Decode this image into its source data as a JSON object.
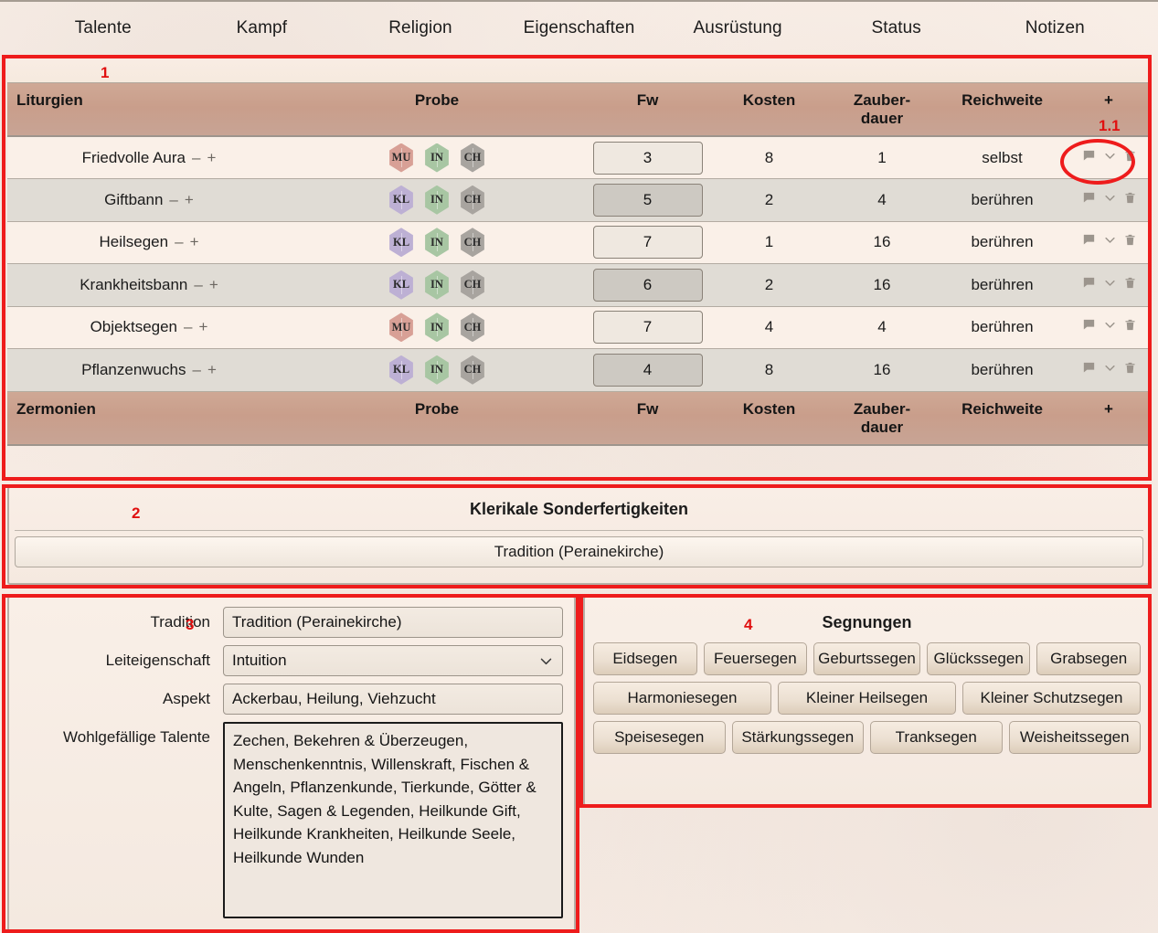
{
  "nav": {
    "items": [
      {
        "label": "Talente"
      },
      {
        "label": "Kampf"
      },
      {
        "label": "Religion"
      },
      {
        "label": "Eigenschaften"
      },
      {
        "label": "Ausrüstung"
      },
      {
        "label": "Status"
      },
      {
        "label": "Notizen"
      }
    ]
  },
  "annotations": {
    "n1": "1",
    "n1_1": "1.1",
    "n2": "2",
    "n3": "3",
    "n4": "4",
    "color": "#ee1c1c"
  },
  "liturgies": {
    "headers": {
      "name": "Liturgien",
      "probe": "Probe",
      "fw": "Fw",
      "kosten": "Kosten",
      "zauberdauer_1": "Zauber-",
      "zauberdauer_2": "dauer",
      "reichweite": "Reichweite",
      "add": "+"
    },
    "rows": [
      {
        "name": "Friedvolle Aura",
        "minus": "–",
        "plus": "+",
        "attrs": [
          "MU",
          "IN",
          "CH"
        ],
        "fw": "3",
        "kosten": "8",
        "zauberdauer": "1",
        "reichweite": "selbst"
      },
      {
        "name": "Giftbann",
        "minus": "–",
        "plus": "+",
        "attrs": [
          "KL",
          "IN",
          "CH"
        ],
        "fw": "5",
        "kosten": "2",
        "zauberdauer": "4",
        "reichweite": "berühren"
      },
      {
        "name": "Heilsegen",
        "minus": "–",
        "plus": "+",
        "attrs": [
          "KL",
          "IN",
          "CH"
        ],
        "fw": "7",
        "kosten": "1",
        "zauberdauer": "16",
        "reichweite": "berühren"
      },
      {
        "name": "Krankheitsbann",
        "minus": "–",
        "plus": "+",
        "attrs": [
          "KL",
          "IN",
          "CH"
        ],
        "fw": "6",
        "kosten": "2",
        "zauberdauer": "16",
        "reichweite": "berühren"
      },
      {
        "name": "Objektsegen",
        "minus": "–",
        "plus": "+",
        "attrs": [
          "MU",
          "IN",
          "CH"
        ],
        "fw": "7",
        "kosten": "4",
        "zauberdauer": "4",
        "reichweite": "berühren"
      },
      {
        "name": "Pflanzenwuchs",
        "minus": "–",
        "plus": "+",
        "attrs": [
          "KL",
          "IN",
          "CH"
        ],
        "fw": "4",
        "kosten": "8",
        "zauberdauer": "16",
        "reichweite": "berühren"
      }
    ]
  },
  "ceremonies": {
    "headers": {
      "name": "Zermonien",
      "probe": "Probe",
      "fw": "Fw",
      "kosten": "Kosten",
      "zauberdauer_1": "Zauber-",
      "zauberdauer_2": "dauer",
      "reichweite": "Reichweite",
      "add": "+"
    },
    "rows": []
  },
  "special_abilities": {
    "title": "Klerikale Sonderfertigkeiten",
    "items": [
      {
        "label": "Tradition (Perainekirche)"
      }
    ]
  },
  "tradition_form": {
    "labels": {
      "tradition": "Tradition",
      "leiteigenschaft": "Leiteigenschaft",
      "aspekt": "Aspekt",
      "wohlgefaellige_talente": "Wohlgefällige Talente"
    },
    "values": {
      "tradition": "Tradition (Perainekirche)",
      "leiteigenschaft": "Intuition",
      "aspekt": "Ackerbau, Heilung, Viehzucht",
      "wohlgefaellige_talente": "Zechen, Bekehren & Überzeugen, Menschenkenntnis, Willenskraft, Fischen & Angeln, Pflanzenkunde, Tierkunde, Götter & Kulte, Sagen & Legenden, Heilkunde Gift, Heilkunde Krankheiten, Heilkunde Seele, Heilkunde Wunden"
    }
  },
  "blessings": {
    "title": "Segnungen",
    "rows": [
      [
        "Eidsegen",
        "Feuersegen",
        "Geburtssegen",
        "Glückssegen",
        "Grabsegen"
      ],
      [
        "Harmoniesegen",
        "Kleiner Heilsegen",
        "Kleiner Schutzsegen"
      ],
      [
        "Speisesegen",
        "Stärkungssegen",
        "Tranksegen",
        "Weisheitssegen"
      ]
    ]
  },
  "icons": {
    "comment": "comment-icon",
    "chevron": "chevron-down-icon",
    "trash": "trash-icon"
  },
  "colors": {
    "MU": "#d8a096",
    "KL": "#bdb0d4",
    "IN": "#a8c6a3",
    "CH": "#a8a49f",
    "header_band": "#c99e8b",
    "annotation_red": "#ee1c1c"
  }
}
